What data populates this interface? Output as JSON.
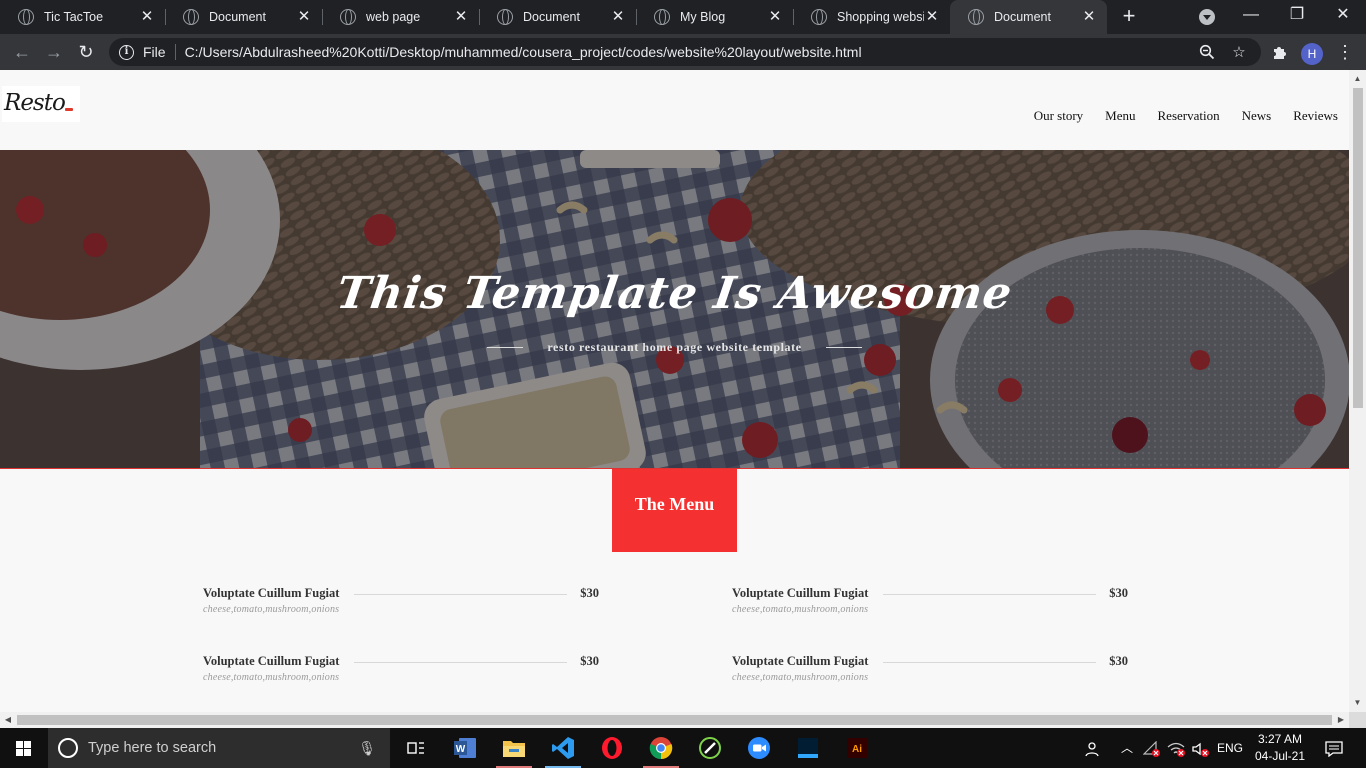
{
  "browser": {
    "tabs": [
      {
        "title": "Tic TacToe",
        "active": false
      },
      {
        "title": "Document",
        "active": false
      },
      {
        "title": "web page",
        "active": false
      },
      {
        "title": "Document",
        "active": false
      },
      {
        "title": "My Blog",
        "active": false
      },
      {
        "title": "Shopping website",
        "active": false
      },
      {
        "title": "Document",
        "active": true
      }
    ],
    "new_tab_label": "+",
    "window_buttons": {
      "minimize": "—",
      "restore": "❐",
      "close": "✕"
    },
    "scheme_label": "File",
    "url": "C:/Users/Abdulrasheed%20Kotti/Desktop/muhammed/cousera_project/codes/website%20layout/website.html",
    "profile_initial": "H"
  },
  "site": {
    "logo": "Resto",
    "nav": [
      "Our story",
      "Menu",
      "Reservation",
      "News",
      "Reviews"
    ],
    "hero": {
      "title": "This Template Is Awesome",
      "subtitle": "resto restaurant home page website template"
    },
    "menu_heading": "The Menu",
    "menu_items": [
      {
        "name": "Voluptate Cuillum Fugiat",
        "price": "$30",
        "desc": "cheese,tomato,mushroom,onions"
      },
      {
        "name": "Voluptate Cuillum Fugiat",
        "price": "$30",
        "desc": "cheese,tomato,mushroom,onions"
      },
      {
        "name": "Voluptate Cuillum Fugiat",
        "price": "$30",
        "desc": "cheese,tomato,mushroom,onions"
      },
      {
        "name": "Voluptate Cuillum Fugiat",
        "price": "$30",
        "desc": "cheese,tomato,mushroom,onions"
      }
    ]
  },
  "taskbar": {
    "search_placeholder": "Type here to search",
    "language": "ENG",
    "time": "3:27 AM",
    "date": "04-Jul-21",
    "apps": [
      "task-view-icon",
      "word-icon",
      "file-explorer-icon",
      "vscode-icon",
      "opera-icon",
      "chrome-icon",
      "maps-icon",
      "zoom-icon",
      "photoshop-icon",
      "illustrator-icon"
    ],
    "illustrator_label": "Ai"
  }
}
